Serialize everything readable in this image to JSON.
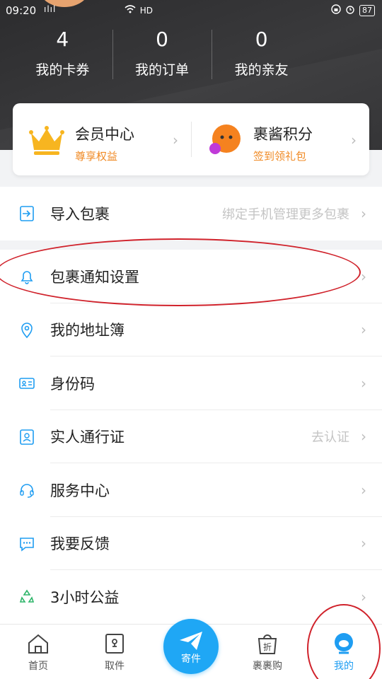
{
  "status_bar": {
    "time": "09:20",
    "signal": "ılıl",
    "network": "HD",
    "battery": "87"
  },
  "stats": [
    {
      "value": "4",
      "label": "我的卡券"
    },
    {
      "value": "0",
      "label": "我的订单"
    },
    {
      "value": "0",
      "label": "我的亲友"
    }
  ],
  "membership_card": {
    "member": {
      "title": "会员中心",
      "subtitle": "尊享权益"
    },
    "points": {
      "title": "裹酱积分",
      "subtitle": "签到领礼包"
    }
  },
  "import_row": {
    "label": "导入包裹",
    "hint": "绑定手机管理更多包裹"
  },
  "menu": [
    {
      "label": "包裹通知设置",
      "icon": "bell-icon",
      "hint": ""
    },
    {
      "label": "我的地址簿",
      "icon": "location-pin-icon",
      "hint": ""
    },
    {
      "label": "身份码",
      "icon": "id-card-icon",
      "hint": ""
    },
    {
      "label": "实人通行证",
      "icon": "person-badge-icon",
      "hint": "去认证"
    },
    {
      "label": "服务中心",
      "icon": "headset-icon",
      "hint": ""
    },
    {
      "label": "我要反馈",
      "icon": "chat-bubble-icon",
      "hint": ""
    },
    {
      "label": "3小时公益",
      "icon": "recycle-leaf-icon",
      "hint": ""
    }
  ],
  "tabs": [
    {
      "label": "首页",
      "icon": "home-icon"
    },
    {
      "label": "取件",
      "icon": "locker-icon"
    },
    {
      "label": "寄件",
      "icon": "paper-plane-icon"
    },
    {
      "label": "裹裹购",
      "icon": "shopping-bag-icon"
    },
    {
      "label": "我的",
      "icon": "profile-icon"
    }
  ],
  "colors": {
    "accent": "#1fa7f5",
    "orange": "#f08a24",
    "annotation": "#d0222b",
    "header_bg": "#2f2f31"
  }
}
